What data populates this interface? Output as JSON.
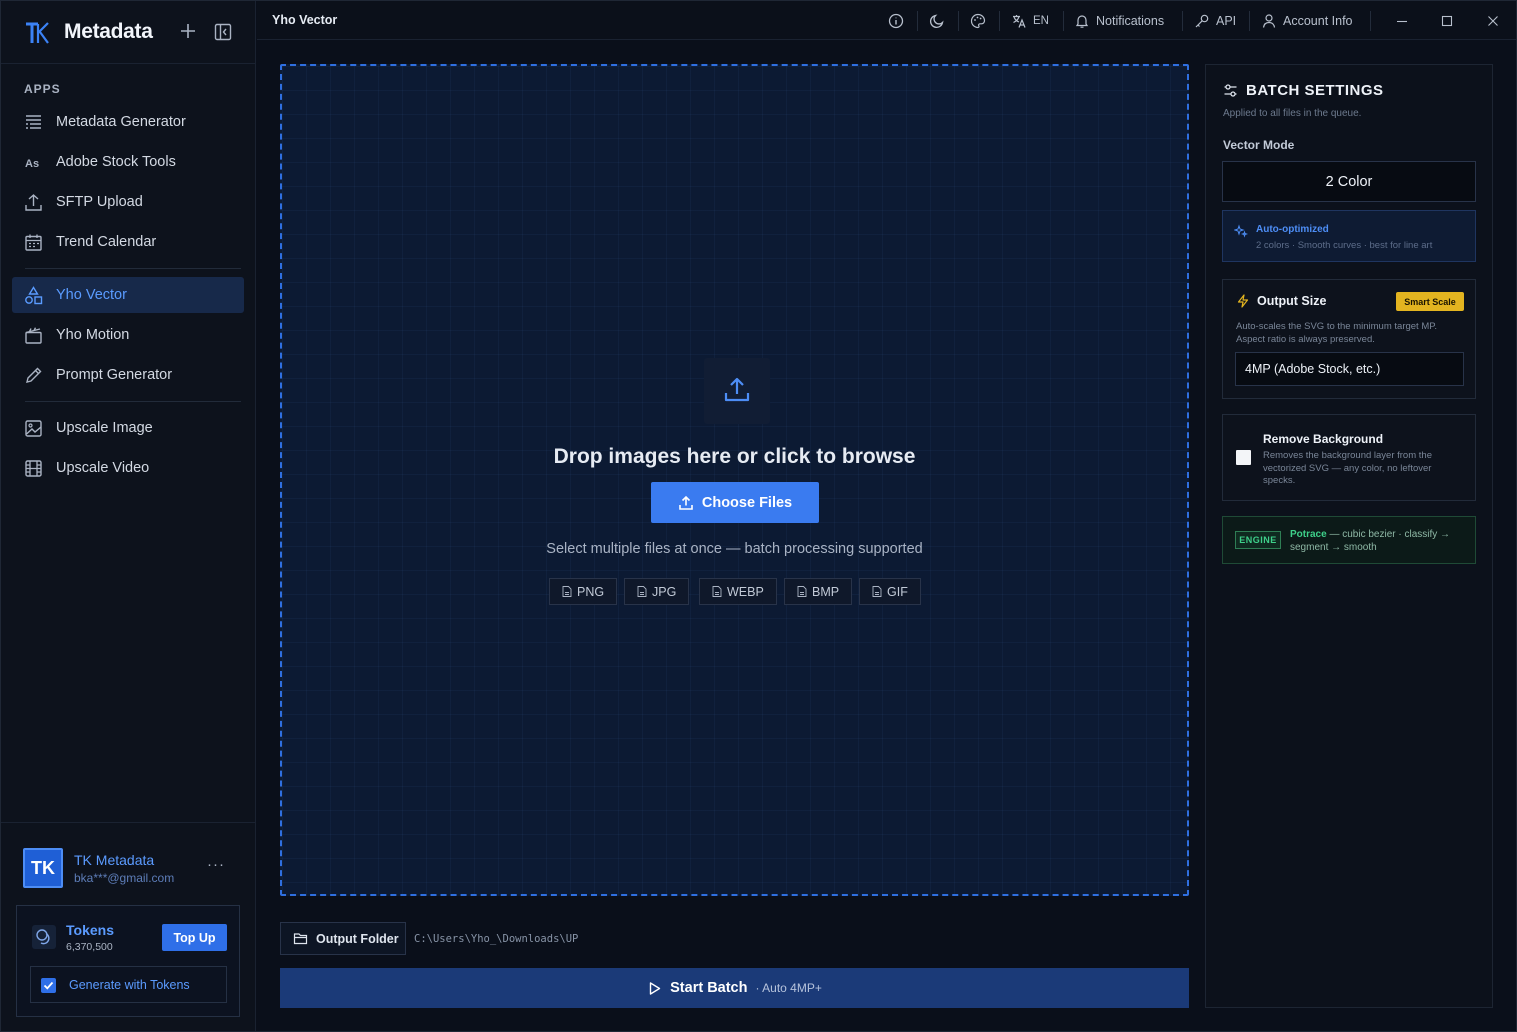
{
  "sidebar": {
    "brand": "Metadata",
    "section_label": "APPS",
    "items": [
      {
        "label": "Metadata Generator",
        "icon": "list-icon"
      },
      {
        "label": "Adobe Stock Tools",
        "icon": "adobe-stock-icon"
      },
      {
        "label": "SFTP Upload",
        "icon": "upload-icon"
      },
      {
        "label": "Trend Calendar",
        "icon": "calendar-icon"
      },
      {
        "label": "Yho Vector",
        "icon": "shapes-icon",
        "active": true
      },
      {
        "label": "Yho Motion",
        "icon": "clapper-icon"
      },
      {
        "label": "Prompt Generator",
        "icon": "pencil-icon"
      },
      {
        "label": "Upscale Image",
        "icon": "image-icon"
      },
      {
        "label": "Upscale Video",
        "icon": "film-icon"
      }
    ],
    "user": {
      "initials": "TK",
      "name": "TK Metadata",
      "email": "bka***@gmail.com",
      "more": "···"
    },
    "tokens": {
      "label": "Tokens",
      "count": "6,370,500",
      "topup": "Top Up",
      "generate_label": "Generate with Tokens",
      "generate_checked": true
    }
  },
  "topbar": {
    "title": "Yho Vector",
    "language": "EN",
    "notifications": "Notifications",
    "api": "API",
    "account": "Account Info"
  },
  "dropzone": {
    "title": "Drop images here or click to browse",
    "button": "Choose Files",
    "subtitle": "Select multiple files at once — batch processing supported",
    "formats": [
      "PNG",
      "JPG",
      "WEBP",
      "BMP",
      "GIF"
    ]
  },
  "output": {
    "button": "Output Folder",
    "path": "C:\\Users\\Yho_\\Downloads\\UP"
  },
  "start": {
    "label": "Start Batch",
    "suffix": "· Auto 4MP+"
  },
  "settings": {
    "title": "BATCH SETTINGS",
    "subtitle": "Applied to all files in the queue.",
    "vector_mode_label": "Vector Mode",
    "vector_mode_value": "2 Color",
    "auto_title": "Auto-optimized",
    "auto_desc": "2 colors · Smooth curves · best for line art",
    "output_size_title": "Output Size",
    "output_size_badge": "Smart Scale",
    "output_size_desc": "Auto-scales the SVG to the minimum target MP. Aspect ratio is always preserved.",
    "output_size_value": "4MP (Adobe Stock, etc.)",
    "remove_bg_title": "Remove Background",
    "remove_bg_desc": "Removes the background layer from the vectorized SVG — any color, no leftover specks.",
    "remove_bg_checked": false,
    "engine_badge": "ENGINE",
    "engine_name": "Potrace",
    "engine_desc": " — cubic bezier · classify → segment → smooth"
  },
  "colors": {
    "accent": "#3a7bf0",
    "active_nav": "#17294a",
    "badge": "#e3b420",
    "engine": "#3ed08a"
  }
}
